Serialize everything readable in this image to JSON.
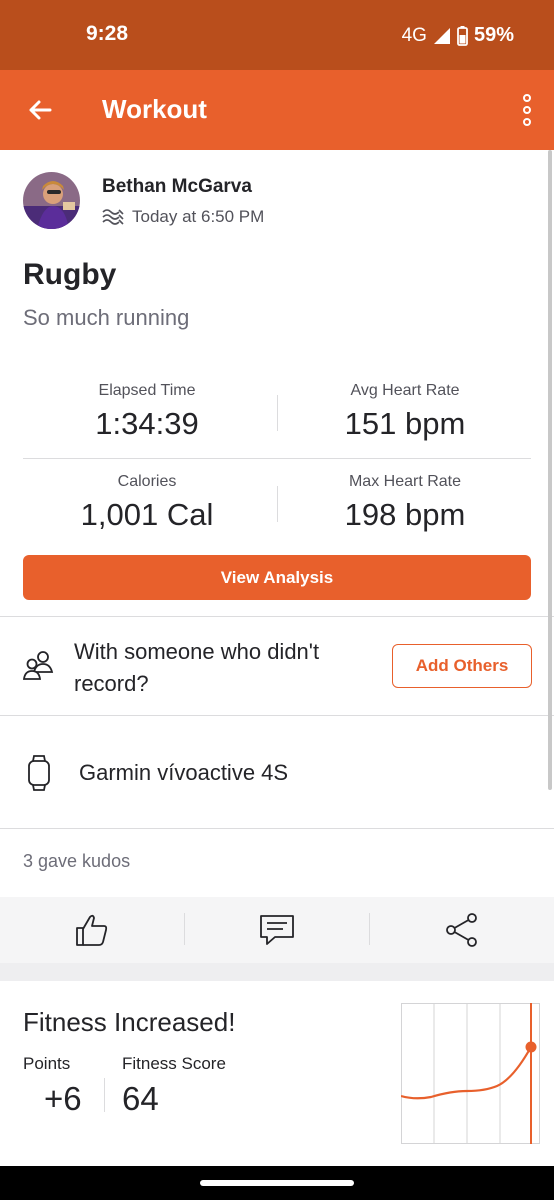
{
  "status_bar": {
    "time": "9:28",
    "network": "4G",
    "battery": "59%"
  },
  "app_bar": {
    "title": "Workout"
  },
  "activity": {
    "athlete_name": "Bethan McGarva",
    "timestamp": "Today at 6:50 PM",
    "title": "Rugby",
    "description": "So much running"
  },
  "stats": {
    "elapsed_time": {
      "label": "Elapsed Time",
      "value": "1:34:39"
    },
    "avg_hr": {
      "label": "Avg Heart Rate",
      "value": "151 bpm"
    },
    "calories": {
      "label": "Calories",
      "value": "1,001 Cal"
    },
    "max_hr": {
      "label": "Max Heart Rate",
      "value": "198 bpm"
    }
  },
  "view_analysis_label": "View Analysis",
  "group": {
    "text": "With someone who didn't record?",
    "button_label": "Add Others"
  },
  "device": {
    "name": "Garmin vívoactive 4S"
  },
  "kudos": {
    "text": "3 gave kudos"
  },
  "fitness": {
    "title": "Fitness Increased!",
    "points_label": "Points",
    "points_value": "+6",
    "score_label": "Fitness Score",
    "score_value": "64"
  },
  "colors": {
    "accent": "#e8602c",
    "status_bar": "#b94e1c"
  }
}
